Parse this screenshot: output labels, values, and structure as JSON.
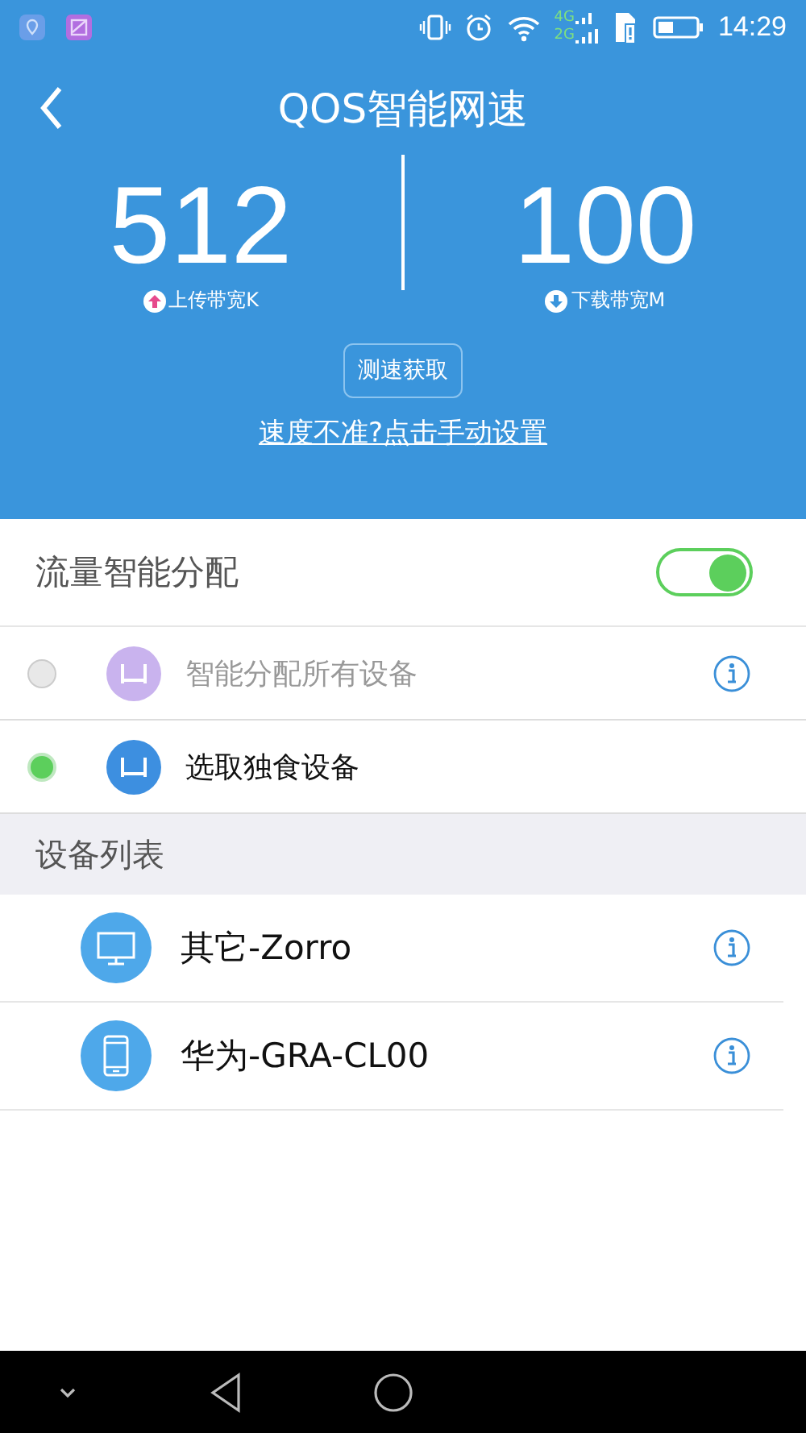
{
  "status_bar": {
    "time": "14:29",
    "network_labels": [
      "4G",
      "2G"
    ]
  },
  "header": {
    "title": "QOS智能网速",
    "stats": [
      {
        "value": "512",
        "label": "上传带宽K",
        "kind": "upload"
      },
      {
        "value": "100",
        "label": "下载带宽M",
        "kind": "download"
      }
    ],
    "measure_button": "测速获取",
    "manual_link": "速度不准?点击手动设置"
  },
  "smart_allocation": {
    "label": "流量智能分配",
    "on": true
  },
  "options": [
    {
      "label": "智能分配所有设备",
      "selected": false,
      "color": "#c9b3ee",
      "info": true
    },
    {
      "label": "选取独食设备",
      "selected": true,
      "color": "#3d8fe0",
      "info": false
    }
  ],
  "device_list": {
    "title": "设备列表",
    "devices": [
      {
        "name": "其它-Zorro",
        "kind": "desktop"
      },
      {
        "name": "华为-GRA-CL00",
        "kind": "phone"
      }
    ]
  }
}
